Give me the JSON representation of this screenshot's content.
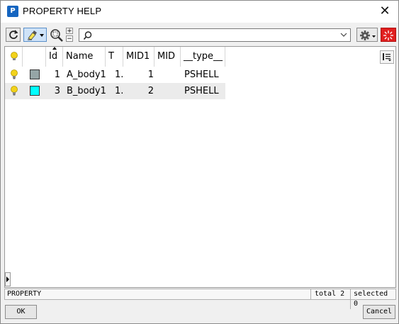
{
  "window": {
    "title": "PROPERTY HELP",
    "app_icon_text": "P"
  },
  "toolbar": {
    "search": {
      "value": "",
      "placeholder": ""
    },
    "zoom_plus": "+",
    "zoom_minus": "−"
  },
  "table": {
    "columns": [
      "Id",
      "Name",
      "T",
      "MID1",
      "MID",
      "__type__"
    ],
    "rows": [
      {
        "id": "1",
        "name": "A_body1",
        "t": "1.",
        "mid1": "1",
        "mid": "",
        "type": "PSHELL",
        "color": "#95a5a6",
        "selected": false
      },
      {
        "id": "3",
        "name": "B_body1",
        "t": "1.",
        "mid1": "2",
        "mid": "",
        "type": "PSHELL",
        "color": "#00ffff",
        "selected": true
      }
    ]
  },
  "status": {
    "left": "PROPERTY",
    "total": "total 2",
    "selected": "selected 0"
  },
  "footer": {
    "ok_label": "OK",
    "cancel_label": "Cancel"
  },
  "colors": {
    "bulb": "#f2d21b",
    "accent": "#5a8fc8",
    "stop": "#e02020"
  }
}
